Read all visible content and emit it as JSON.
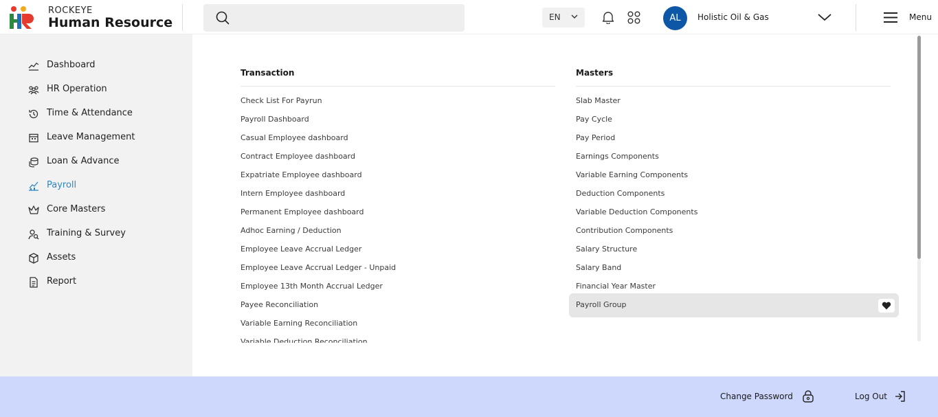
{
  "header": {
    "brand_top": "ROCKEYE",
    "brand_main": "Human Resource",
    "language": "EN",
    "avatar_initials": "AL",
    "company": "Holistic Oil & Gas",
    "menu_label": "Menu",
    "colors": {
      "avatar": "#0d57a6"
    }
  },
  "sidebar": {
    "active_color": "#2f86c7",
    "items": [
      {
        "label": "Dashboard",
        "icon": "chart-line-icon"
      },
      {
        "label": "HR Operation",
        "icon": "people-group-icon"
      },
      {
        "label": "Time & Attendance",
        "icon": "history-clock-icon"
      },
      {
        "label": "Leave Management",
        "icon": "calendar-icon"
      },
      {
        "label": "Loan & Advance",
        "icon": "coins-icon"
      },
      {
        "label": "Payroll",
        "icon": "payroll-chart-icon",
        "active": true
      },
      {
        "label": "Core Masters",
        "icon": "crown-icon"
      },
      {
        "label": "Training & Survey",
        "icon": "user-search-icon"
      },
      {
        "label": "Assets",
        "icon": "box-icon"
      },
      {
        "label": "Report",
        "icon": "document-icon"
      }
    ]
  },
  "main": {
    "transaction": {
      "title": "Transaction",
      "items": [
        "Check List For Payrun",
        "Payroll Dashboard",
        "Casual Employee dashboard",
        "Contract Employee dashboard",
        "Expatriate Employee dashboard",
        "Intern Employee dashboard",
        "Permanent Employee dashboard",
        "Adhoc Earning / Deduction",
        "Employee Leave Accrual Ledger",
        "Employee Leave Accrual Ledger - Unpaid",
        "Employee 13th Month Accrual Ledger",
        "Payee Reconciliation",
        "Variable Earning Reconciliation",
        "Variable Deduction Reconciliation"
      ]
    },
    "masters": {
      "title": "Masters",
      "items": [
        "Slab Master",
        "Pay Cycle",
        "Pay Period",
        "Earnings Components",
        "Variable Earning Components",
        "Deduction Components",
        "Variable Deduction Components",
        "Contribution Components",
        "Salary Structure",
        "Salary Band",
        "Financial Year Master",
        "Payroll Group"
      ],
      "highlighted": "Payroll Group"
    }
  },
  "footer": {
    "change_password": "Change Password",
    "log_out": "Log Out",
    "background": "#cdd8fc"
  }
}
